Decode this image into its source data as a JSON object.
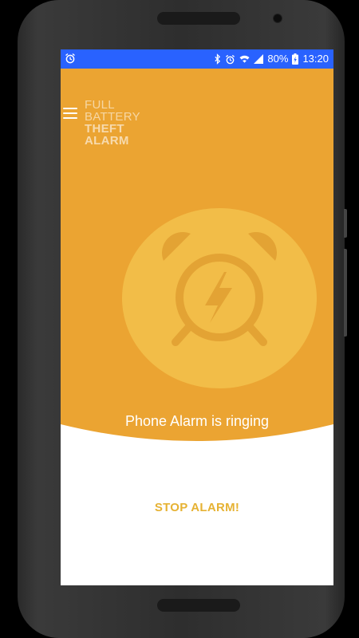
{
  "status_bar": {
    "battery_percent": "80%",
    "time": "13:20",
    "left_icon": "alarm-clock-icon",
    "right_icons": [
      "bluetooth-icon",
      "alarm-icon",
      "wifi-icon",
      "signal-icon",
      "battery-charging-icon"
    ],
    "color": "#2962ff"
  },
  "app": {
    "logo_line1": "FULL",
    "logo_line2": "BATTERY",
    "logo_line3": "THEFT",
    "logo_line4": "ALARM",
    "menu_icon": "hamburger-menu-icon",
    "main_icon": "alarm-clock-bolt-icon",
    "status_message": "Phone Alarm is ringing",
    "stop_label": "STOP ALARM!",
    "accent_color": "#eba432",
    "button_color": "#e6b233"
  }
}
